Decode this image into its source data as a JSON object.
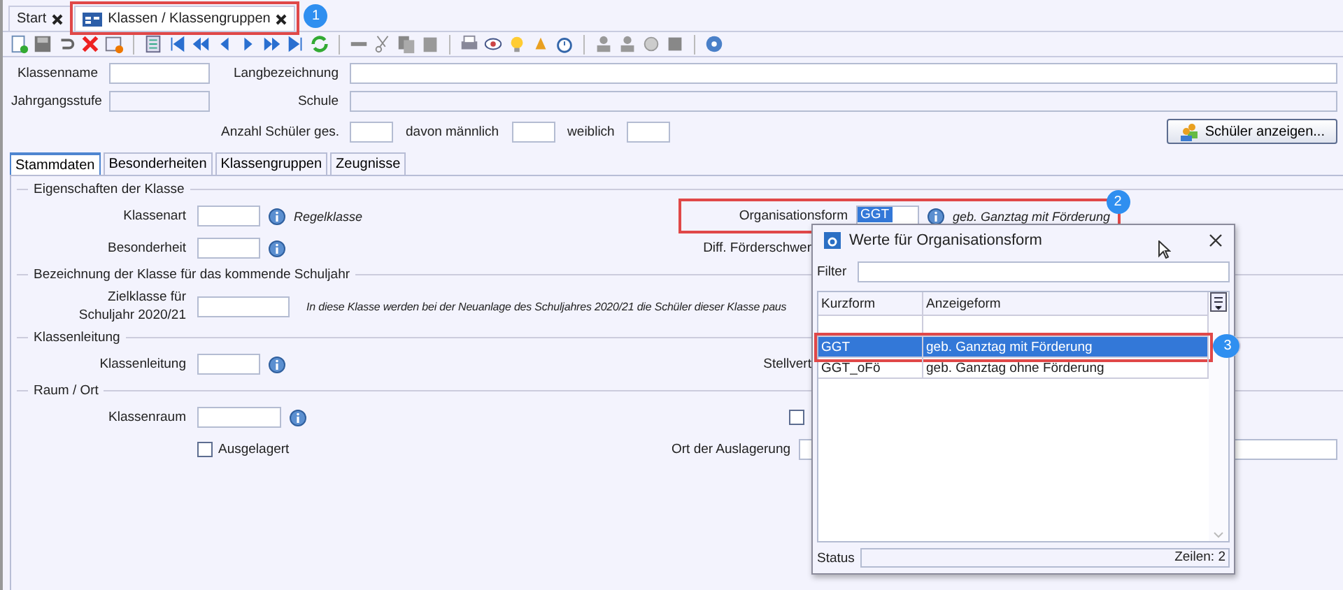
{
  "document_tabs": [
    {
      "label": "Start",
      "selected": false
    },
    {
      "label": "Klassen / Klassengruppen",
      "selected": true,
      "callout": "1"
    }
  ],
  "header": {
    "klassenname": "Klassenname",
    "langbezeichnung": "Langbezeichnung",
    "jahrgangsstufe": "Jahrgangsstufe",
    "schule": "Schule",
    "anzahl": "Anzahl Schüler ges.",
    "maennlich": "davon männlich",
    "weiblich": "weiblich",
    "button": "Schüler anzeigen..."
  },
  "tabs": [
    {
      "label": "Stammdaten",
      "selected": true
    },
    {
      "label": "Besonderheiten",
      "selected": false
    },
    {
      "label": "Klassengruppen",
      "selected": false
    },
    {
      "label": "Zeugnisse",
      "selected": false
    }
  ],
  "sections": [
    {
      "title": "Eigenschaften der Klasse",
      "rows": [
        {
          "label": "Klassenart",
          "info": true,
          "hint": "Regelklasse",
          "right_label": "Organisationsform",
          "right_value": "GGT",
          "right_hint": "geb. Ganztag mit Förderung",
          "right_callout": "2"
        },
        {
          "label": "Besonderheit",
          "info": true,
          "right_label": "Diff. Förderschwer"
        }
      ]
    },
    {
      "title": "Bezeichnung der Klasse für das kommende Schuljahr",
      "rows": [
        {
          "label": "Zielklasse für Schuljahr 2020/21",
          "note": "In diese Klasse werden bei der Neuanlage des Schuljahres 2020/21 die Schüler dieser Klasse paus"
        }
      ]
    },
    {
      "title": "Klassenleitung",
      "rows": [
        {
          "label": "Klassenleitung",
          "info": true,
          "right_label": "Stellvert"
        }
      ]
    },
    {
      "title": "Raum / Ort",
      "rows": [
        {
          "label": "Klassenraum",
          "info": true,
          "right_checkbox": {
            "checked": false
          }
        },
        {
          "checkbox": {
            "label": "Ausgelagert",
            "checked": false
          },
          "right_label": "Ort der Auslagerung",
          "right_field": true
        }
      ]
    }
  ],
  "dialog": {
    "title": "Werte für Organisationsform",
    "filter_label": "Filter",
    "columns": [
      "Kurzform",
      "Anzeigeform"
    ],
    "rows": [
      {
        "kind": "blank",
        "selected": false
      },
      {
        "kind": "value",
        "kurzform": "GGT",
        "anzeigeform": "geb. Ganztag mit Förderung",
        "selected": true,
        "callout": "3"
      },
      {
        "kind": "value",
        "kurzform": "GGT_oFö",
        "anzeigeform": "geb. Ganztag ohne Förderung",
        "selected": false
      }
    ],
    "status_label": "Status",
    "status_value": "Zeilen: 2"
  }
}
